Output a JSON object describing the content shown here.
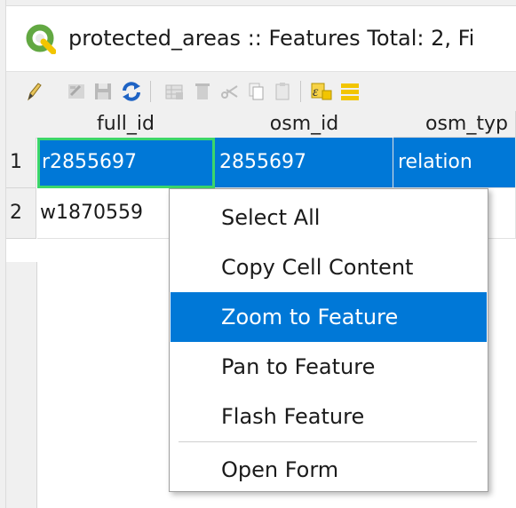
{
  "window": {
    "title": "protected_areas :: Features Total: 2, Fi"
  },
  "toolbar": {
    "icons": [
      "pencil-icon",
      "multi-edit-icon",
      "save-icon",
      "reload-icon",
      "add-feature-icon",
      "delete-feature-icon",
      "cut-icon",
      "copy-icon",
      "paste-icon",
      "expression-select-icon",
      "select-all-icon"
    ]
  },
  "table": {
    "columns": [
      "full_id",
      "osm_id",
      "osm_typ"
    ],
    "rows": [
      {
        "num": "1",
        "full_id": "r2855697",
        "osm_id": "2855697",
        "osm_type": "relation"
      },
      {
        "num": "2",
        "full_id": "w1870559",
        "osm_id": "",
        "osm_type": ""
      }
    ]
  },
  "context_menu": {
    "items": [
      "Select All",
      "Copy Cell Content",
      "Zoom to Feature",
      "Pan to Feature",
      "Flash Feature",
      "Open Form"
    ],
    "highlighted": "Zoom to Feature"
  },
  "colors": {
    "selection": "#0078d7",
    "focus": "#3cd66a",
    "qgis_green": "#62a842",
    "toolbar_yellow": "#f2c500"
  }
}
